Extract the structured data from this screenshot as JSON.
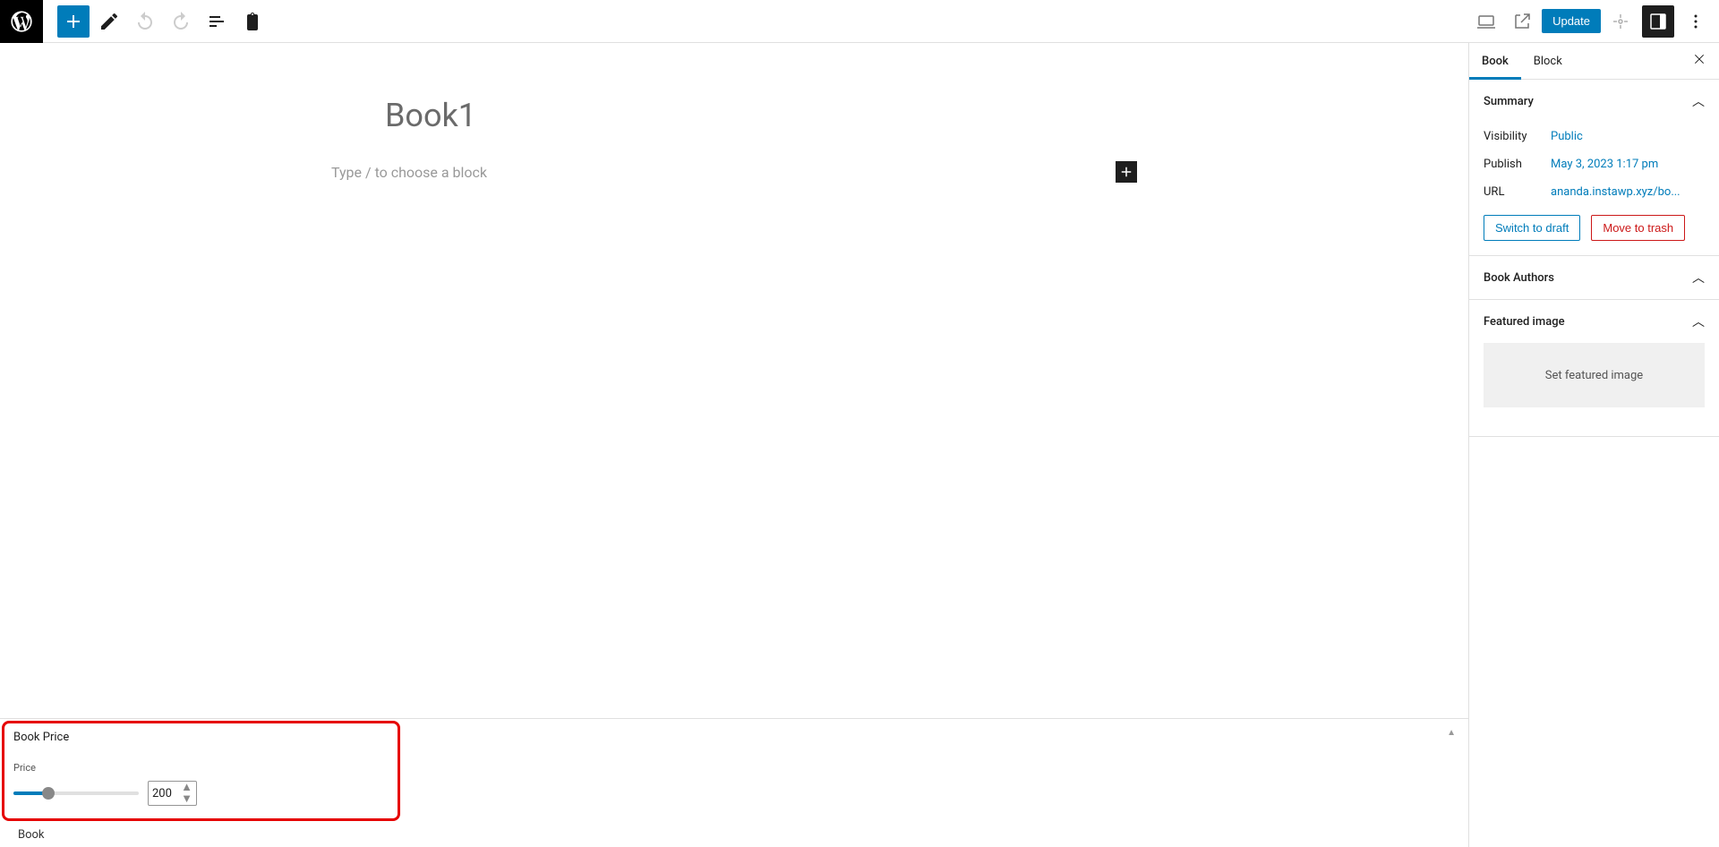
{
  "toolbar": {
    "update_label": "Update"
  },
  "editor": {
    "post_title": "Book1",
    "placeholder": "Type / to choose a block"
  },
  "book_price": {
    "section_title": "Book Price",
    "field_label": "Price",
    "value": "200"
  },
  "breadcrumb": "Book",
  "sidebar": {
    "tabs": {
      "post": "Book",
      "block": "Block"
    },
    "summary": {
      "title": "Summary",
      "visibility_label": "Visibility",
      "visibility_value": "Public",
      "publish_label": "Publish",
      "publish_value": "May 3, 2023 1:17 pm",
      "url_label": "URL",
      "url_value": "ananda.instawp.xyz/bo...",
      "switch_draft": "Switch to draft",
      "move_trash": "Move to trash"
    },
    "book_authors_title": "Book Authors",
    "featured_title": "Featured image",
    "featured_button": "Set featured image"
  }
}
